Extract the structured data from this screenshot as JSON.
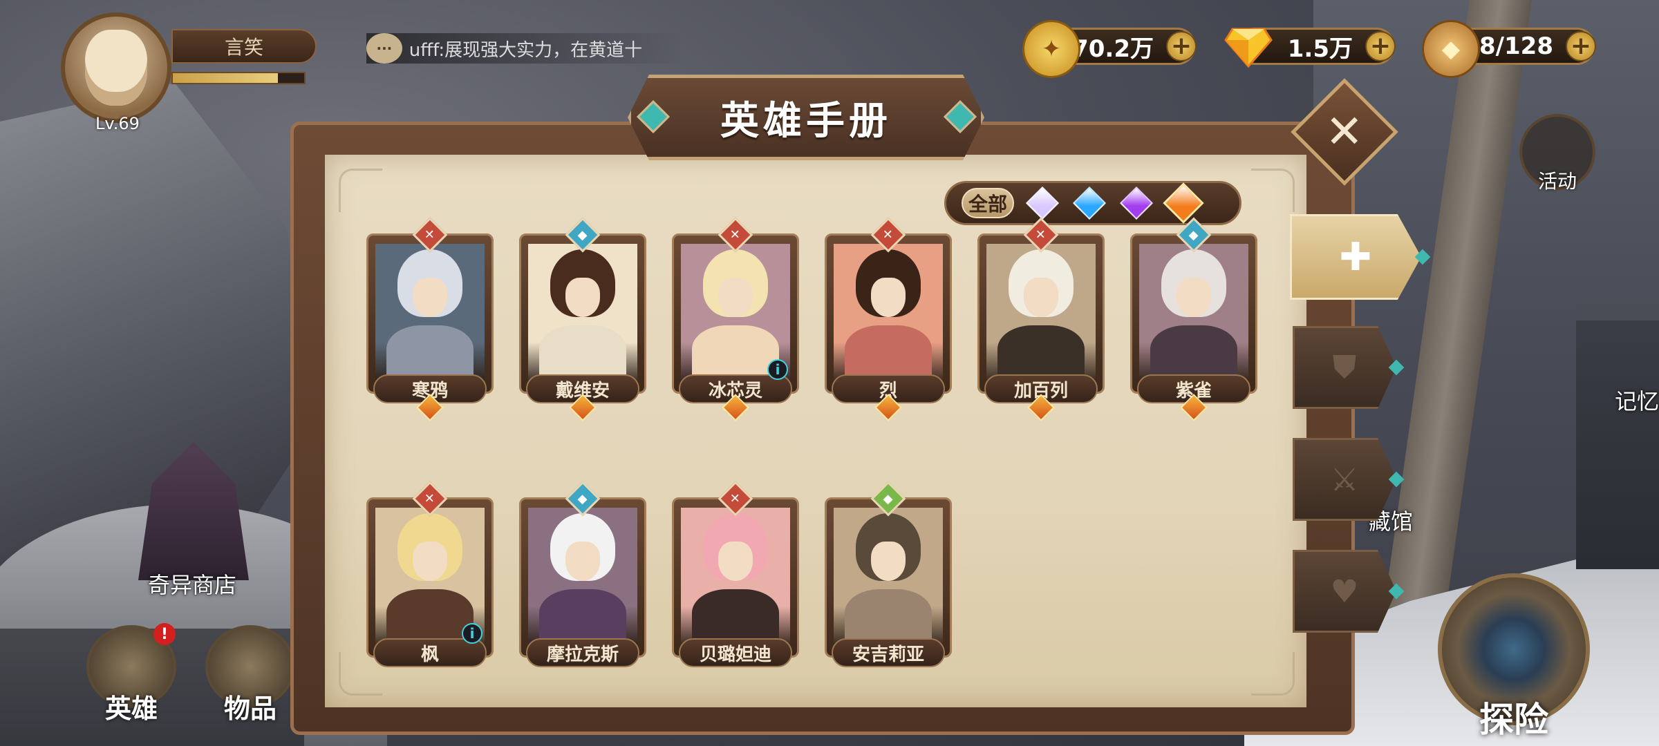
{
  "player": {
    "name": "言笑",
    "level": "Lv.69",
    "exp_fraction": 0.8
  },
  "chat": {
    "icon": "chat-bubble-icon",
    "message": "ufff:展现强大实力，在黄道十"
  },
  "resources": [
    {
      "id": "gold",
      "icon": "gold-coin-icon",
      "value": "70.2万"
    },
    {
      "id": "gem",
      "icon": "diamond-icon",
      "value": "1.5万"
    },
    {
      "id": "stamina",
      "icon": "food-basket-icon",
      "value": "128/128"
    }
  ],
  "activity": {
    "label": "活动"
  },
  "scene_labels": {
    "shop": "奇异商店",
    "memory": "记忆",
    "library": "藏馆"
  },
  "bottom_nav": {
    "hero": "英雄",
    "items": "物品",
    "hero_badge": "!"
  },
  "explore": {
    "label": "探险"
  },
  "panel": {
    "title": "英雄手册",
    "close_symbol": "✕",
    "filter": {
      "all_label": "全部",
      "gems": [
        {
          "name": "light-faction",
          "color": "#d9c8ff"
        },
        {
          "name": "water-faction",
          "color": "#2aa7ff"
        },
        {
          "name": "dark-faction",
          "color": "#a23df0"
        },
        {
          "name": "fire-faction",
          "color": "#f47c1c"
        }
      ]
    },
    "side_tabs": [
      {
        "name": "all",
        "symbol": "✚",
        "active": true
      },
      {
        "name": "tank",
        "symbol": "⛊",
        "active": false
      },
      {
        "name": "warrior",
        "symbol": "⚔",
        "active": false
      },
      {
        "name": "support",
        "symbol": "♥",
        "active": false
      }
    ],
    "heroes": [
      {
        "name": "寒鸦",
        "role": "warrior",
        "role_color": "#c44a3a",
        "hair": "#d8dde6",
        "body": "#8e96a6",
        "bg": "#5a6a7a",
        "info": false
      },
      {
        "name": "戴维安",
        "role": "mage",
        "role_color": "#3fa6c4",
        "hair": "#4a2c1e",
        "body": "#e8ddc6",
        "bg": "#f0e2c9",
        "info": false
      },
      {
        "name": "冰芯灵",
        "role": "warrior",
        "role_color": "#c44a3a",
        "hair": "#f3e3b0",
        "body": "#f0d7b8",
        "bg": "#b8909a",
        "info": true
      },
      {
        "name": "烈",
        "role": "warrior",
        "role_color": "#c44a3a",
        "hair": "#3a2418",
        "body": "#c66b60",
        "bg": "#e8a085",
        "info": false
      },
      {
        "name": "加百列",
        "role": "warrior",
        "role_color": "#c44a3a",
        "hair": "#f1ece0",
        "body": "#3a3028",
        "bg": "#bfa88a",
        "info": false
      },
      {
        "name": "紫雀",
        "role": "mage",
        "role_color": "#3fa6c4",
        "hair": "#e6e1dc",
        "body": "#4a3a44",
        "bg": "#a08088",
        "info": false
      },
      {
        "name": "枫",
        "role": "warrior",
        "role_color": "#c44a3a",
        "hair": "#f0d890",
        "body": "#5a3a2a",
        "bg": "#d9c2a0",
        "info": true
      },
      {
        "name": "摩拉克斯",
        "role": "mage",
        "role_color": "#3fa6c4",
        "hair": "#f2f2f2",
        "body": "#5a3e60",
        "bg": "#8a7080",
        "info": false
      },
      {
        "name": "贝璐妲迪",
        "role": "warrior",
        "role_color": "#c44a3a",
        "hair": "#f2a8b0",
        "body": "#3a2a28",
        "bg": "#e8b0a8",
        "info": false
      },
      {
        "name": "安吉莉亚",
        "role": "support",
        "role_color": "#7ab84a",
        "hair": "#5a4a3a",
        "body": "#9a8470",
        "bg": "#c0a888",
        "info": false
      }
    ]
  }
}
